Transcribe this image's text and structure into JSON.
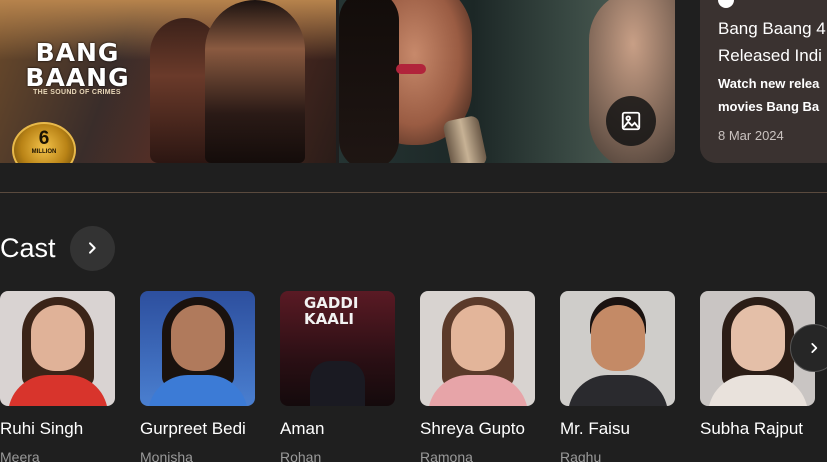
{
  "hero": {
    "poster_title": "BANG BAANG",
    "poster_tagline": "THE SOUND OF CRIMES",
    "badge_number": "6",
    "badge_unit": "MILLION",
    "gallery_icon": "image-icon"
  },
  "news": {
    "title_line1": "Bang Baang 4",
    "title_line2": "Released Indi",
    "sub_line1": "Watch new relea",
    "sub_line2": "movies Bang Ba",
    "date": "8 Mar 2024"
  },
  "cast": {
    "heading": "Cast",
    "members": [
      {
        "name": "Ruhi Singh",
        "role": "Meera"
      },
      {
        "name": "Gurpreet Bedi",
        "role": "Monisha"
      },
      {
        "name": "Aman",
        "role": "Rohan",
        "overlay": "GADDI KAALI"
      },
      {
        "name": "Shreya Gupto",
        "role": "Ramona"
      },
      {
        "name": "Mr. Faisu",
        "role": "Raghu"
      },
      {
        "name": "Subha Rajput",
        "role": ""
      }
    ]
  },
  "colors": {
    "background": "#1f1f1f",
    "news_card": "#3a3230",
    "divider": "#5a4a3e",
    "role_text": "#9a9a9a"
  }
}
